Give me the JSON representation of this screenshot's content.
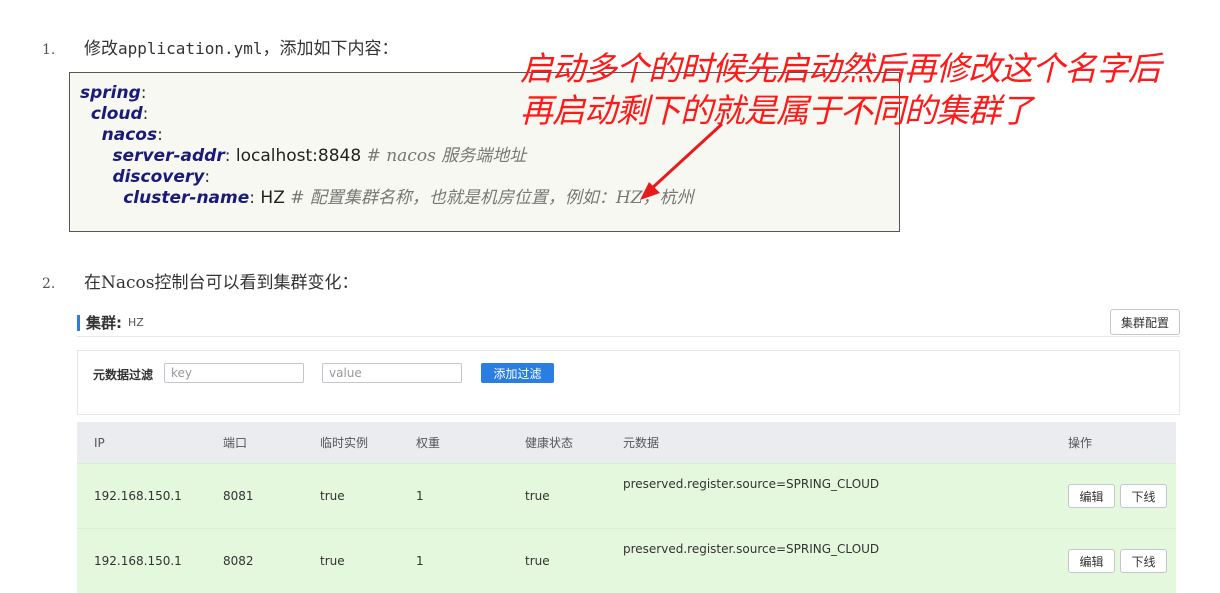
{
  "step1": {
    "num": "1.",
    "text_prefix": "修改",
    "filename": "application.yml",
    "text_suffix": "，添加如下内容："
  },
  "code": {
    "l1_key": "spring",
    "l2_key": "cloud",
    "l3_key": "nacos",
    "l4_key": "server-addr",
    "l4_val": "localhost:8848",
    "l4_cmt": "# nacos 服务端地址",
    "l5_key": "discovery",
    "l6_key": "cluster-name",
    "l6_val": "HZ",
    "l6_cmt": "# 配置集群名称，也就是机房位置，例如：HZ，杭州"
  },
  "annotation": {
    "line1": "启动多个的时候先启动然后再修改这个名字后",
    "line2": "再启动剩下的就是属于不同的集群了",
    "color": "#ff1a1a"
  },
  "step2": {
    "num": "2.",
    "text": "在Nacos控制台可以看到集群变化："
  },
  "cluster": {
    "label": "集群:",
    "name": "HZ",
    "config_button": "集群配置",
    "accent": "#2a7de1"
  },
  "filter": {
    "label": "元数据过滤",
    "key_placeholder": "key",
    "value_placeholder": "value",
    "add_button": "添加过滤"
  },
  "table": {
    "headers": [
      "IP",
      "端口",
      "临时实例",
      "权重",
      "健康状态",
      "元数据",
      "操作"
    ],
    "rows": [
      {
        "ip": "192.168.150.1",
        "port": "8081",
        "ephemeral": "true",
        "weight": "1",
        "healthy": "true",
        "metadata": "preserved.register.source=SPRING_CLOUD",
        "edit": "编辑",
        "offline": "下线"
      },
      {
        "ip": "192.168.150.1",
        "port": "8082",
        "ephemeral": "true",
        "weight": "1",
        "healthy": "true",
        "metadata": "preserved.register.source=SPRING_CLOUD",
        "edit": "编辑",
        "offline": "下线"
      }
    ]
  }
}
